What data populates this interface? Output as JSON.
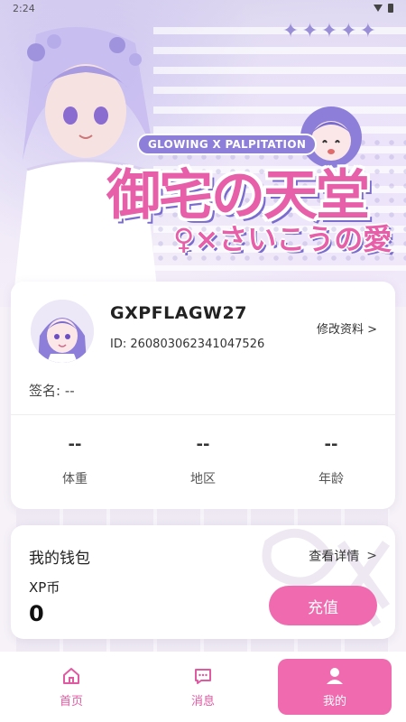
{
  "status_bar": {
    "time": "2:24"
  },
  "hero": {
    "tagline": "GLOWING X PALPITATION",
    "logo_title": "御宅の天堂",
    "logo_subtitle": "♀×さいこうの愛"
  },
  "profile": {
    "username": "GXPFLAGW27",
    "id_text": "ID: 260803062341047526",
    "edit_label": "修改资料 >",
    "signature": "签名: --",
    "stats": [
      {
        "value": "--",
        "label": "体重"
      },
      {
        "value": "--",
        "label": "地区"
      },
      {
        "value": "--",
        "label": "年龄"
      }
    ]
  },
  "wallet": {
    "title": "我的钱包",
    "details_label": "查看详情",
    "currency_label": "XP币",
    "balance": "0",
    "recharge_label": "充值"
  },
  "tabbar": {
    "tabs": [
      {
        "label": "首页",
        "icon": "home-icon"
      },
      {
        "label": "消息",
        "icon": "message-icon"
      },
      {
        "label": "我的",
        "icon": "person-icon"
      }
    ],
    "active_index": 2
  },
  "colors": {
    "accent": "#ef6aae",
    "accent_text": "#e05aa2",
    "hero_purple": "#8d7fd9"
  }
}
